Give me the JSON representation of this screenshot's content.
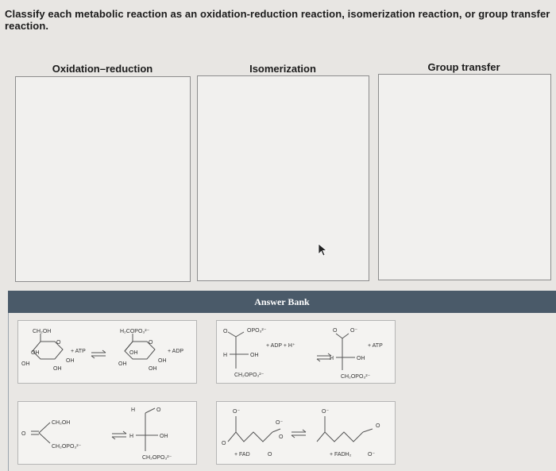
{
  "question": "Classify each metabolic reaction as an oxidation-reduction reaction, isomerization reaction, or group transfer reaction.",
  "categories": [
    "Oxidation–reduction",
    "Isomerization",
    "Group transfer"
  ],
  "answer_bank": {
    "title": "Answer Bank"
  },
  "cards": {
    "glucose_phosphorylation": {
      "reactant_top": "CH₂OH",
      "reactant_oh1": "OH",
      "reactant_oh2": "OH",
      "reactant_oh3": "OH",
      "reactant_oh4": "OH",
      "reactant_o": "O",
      "reagent": "+ ATP",
      "product_top": "H₂COPO₃²⁻",
      "product_oh1": "OH",
      "product_oh2": "OH",
      "product_oh3": "OH",
      "product_oh4": "OH",
      "product_o": "O",
      "byproduct": "+ ADP"
    },
    "bpg_to_3pg": {
      "top_group": "OPO₃²⁻",
      "left_o": "O",
      "h": "H",
      "oh": "OH",
      "bottom": "CH₂OPO₃²⁻",
      "reagent": "+ ADP + H⁺",
      "p_o": "O",
      "p_ominus": "O⁻",
      "p_h": "H",
      "p_oh": "OH",
      "p_bottom": "CH₂OPO₃²⁻",
      "byproduct": "+ ATP"
    },
    "dhap_to_g3p": {
      "o": "O",
      "top": "CH₂OH",
      "bottom": "CH₂OPO₃²⁻",
      "p_h": "H",
      "p_o": "O",
      "p_h2": "H",
      "p_oh": "OH",
      "p_bottom": "CH₂OPO₃²⁻"
    },
    "succinate_fumarate": {
      "o1": "O⁻",
      "o2": "O",
      "o3": "O⁻",
      "o4": "O",
      "reagent": "+ FAD",
      "r_o": "O",
      "p_o1": "O⁻",
      "p_o2": "O",
      "byproduct": "+ FADH₂",
      "p_o3": "O⁻"
    }
  }
}
